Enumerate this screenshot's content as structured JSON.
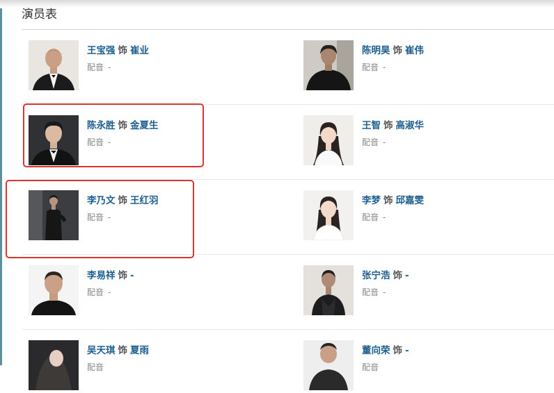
{
  "section": {
    "title": "演员表"
  },
  "cast": [
    {
      "actor": "王宝强",
      "as": "饰",
      "role": "崔业",
      "dub_label": "配音",
      "dub_value": "-"
    },
    {
      "actor": "陈明昊",
      "as": "饰",
      "role": "崔伟",
      "dub_label": "配音",
      "dub_value": "-"
    },
    {
      "actor": "陈永胜",
      "as": "饰",
      "role": "金夏生",
      "dub_label": "配音",
      "dub_value": "-"
    },
    {
      "actor": "王智",
      "as": "饰",
      "role": "高淑华",
      "dub_label": "配音",
      "dub_value": "-"
    },
    {
      "actor": "李乃文",
      "as": "饰",
      "role": "王红羽",
      "dub_label": "配音",
      "dub_value": "-"
    },
    {
      "actor": "李梦",
      "as": "饰",
      "role": "邱嘉雯",
      "dub_label": "配音",
      "dub_value": "-"
    },
    {
      "actor": "李易祥",
      "as": "饰",
      "role": "-",
      "dub_label": "配音",
      "dub_value": "-"
    },
    {
      "actor": "张宁浩",
      "as": "饰",
      "role": "-",
      "dub_label": "配音",
      "dub_value": "-"
    },
    {
      "actor": "吴天琪",
      "as": "饰",
      "role": "夏雨",
      "dub_label": "配音",
      "dub_value": ""
    },
    {
      "actor": "董向荣",
      "as": "饰",
      "role": "-",
      "dub_label": "配音",
      "dub_value": ""
    }
  ],
  "colors": {
    "link": "#1c5e8f",
    "highlight": "#d9352c"
  }
}
